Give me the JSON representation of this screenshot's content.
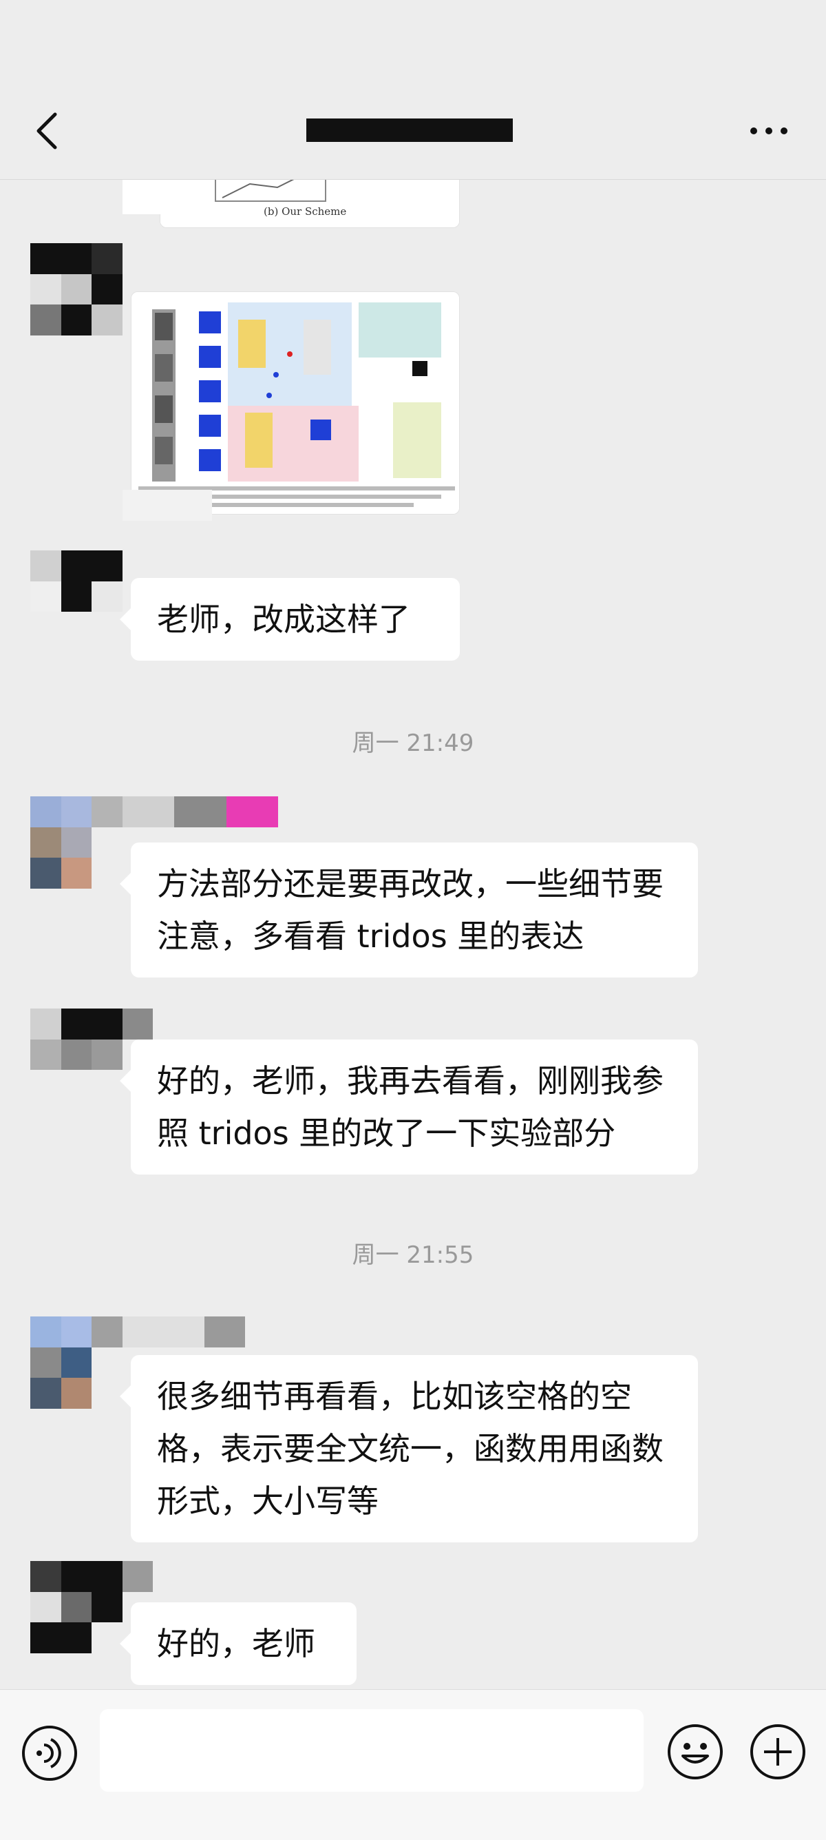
{
  "header": {
    "title": "",
    "back_icon": "chevron-left-icon",
    "more_icon": "more-dots-icon"
  },
  "messages": [
    {
      "type": "image",
      "caption": "(b) Our Scheme"
    },
    {
      "type": "image",
      "caption": ""
    },
    {
      "type": "text",
      "text": "老师，改成这样了"
    },
    {
      "type": "time",
      "text": "周一 21:49"
    },
    {
      "type": "text",
      "text": "方法部分还是要再改改，一些细节要注意，多看看 tridos 里的表达"
    },
    {
      "type": "text",
      "text": "好的，老师，我再去看看，刚刚我参照 tridos 里的改了一下实验部分"
    },
    {
      "type": "time",
      "text": "周一 21:55"
    },
    {
      "type": "text",
      "text": "很多细节再看看，比如该空格的空格，表示要全文统一，函数用用函数形式，大小写等"
    },
    {
      "type": "text",
      "text": "好的，老师"
    }
  ],
  "footer": {
    "input_value": "",
    "voice_icon": "voice-icon",
    "emoji_icon": "emoji-icon",
    "plus_icon": "plus-icon"
  },
  "colors": {
    "background": "#ededed",
    "bubble": "#ffffff",
    "time_text": "#999999"
  }
}
